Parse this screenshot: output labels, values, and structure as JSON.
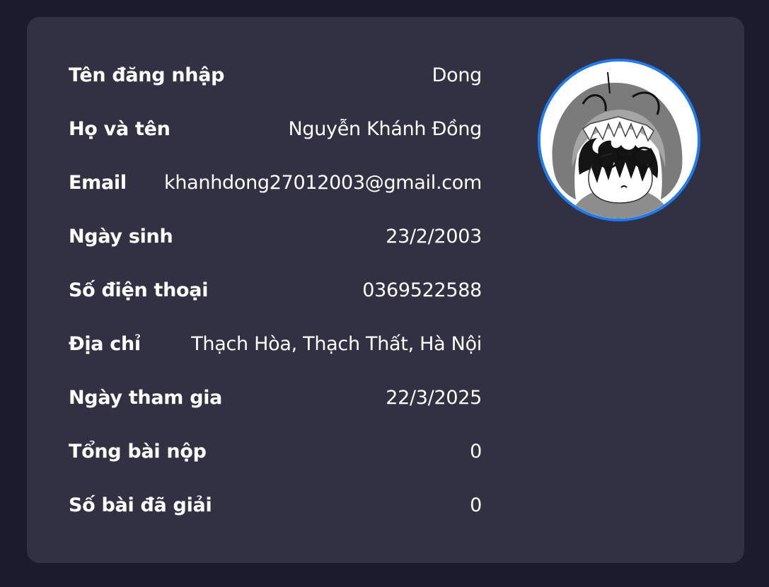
{
  "profile": {
    "fields": [
      {
        "label": "Tên đăng nhập",
        "value": "Dong"
      },
      {
        "label": "Họ và tên",
        "value": "Nguyễn Khánh Đồng"
      },
      {
        "label": "Email",
        "value": "khanhdong27012003@gmail.com"
      },
      {
        "label": "Ngày sinh",
        "value": "23/2/2003"
      },
      {
        "label": "Số điện thoại",
        "value": "0369522588"
      },
      {
        "label": "Địa chỉ",
        "value": "Thạch Hòa, Thạch Thất, Hà Nội"
      },
      {
        "label": "Ngày tham gia",
        "value": "22/3/2025"
      },
      {
        "label": "Tổng bài nộp",
        "value": "0"
      },
      {
        "label": "Số bài đã giải",
        "value": "0"
      }
    ],
    "avatar_icon": "avatar-shark-hood-character",
    "colors": {
      "page_bg": "#1c1b2e",
      "card_bg": "#323144",
      "avatar_border": "#1e7bf0",
      "text": "#ffffff"
    }
  }
}
